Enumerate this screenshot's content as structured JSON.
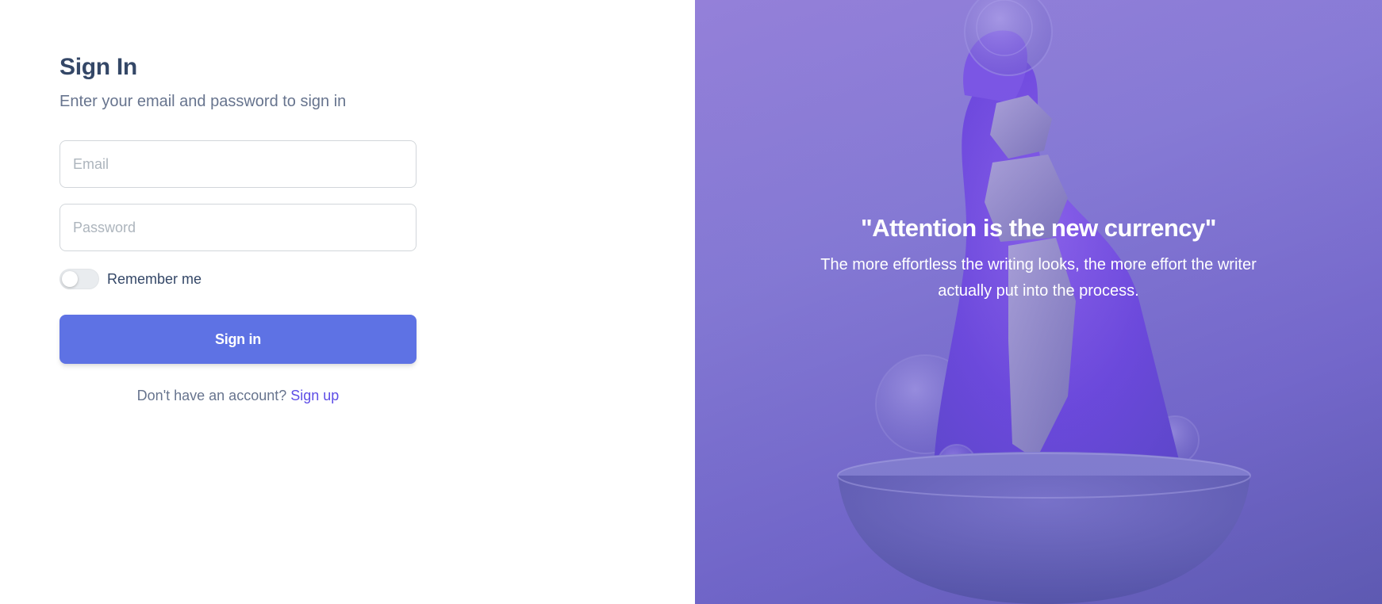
{
  "signin": {
    "title": "Sign In",
    "subtitle": "Enter your email and password to sign in",
    "email_placeholder": "Email",
    "password_placeholder": "Password",
    "remember_label": "Remember me",
    "remember_checked": false,
    "submit_label": "Sign in",
    "signup_prompt": "Don't have an account?",
    "signup_link": "Sign up"
  },
  "hero": {
    "quote_title": "\"Attention is the new currency\"",
    "quote_text": "The more effortless the writing looks, the more effort the writer actually put into the process."
  },
  "colors": {
    "primary": "#5e72e4",
    "link": "#5e4ee6",
    "heading": "#344767",
    "muted": "#67748e",
    "hero_purple": "#8a7fd4"
  }
}
